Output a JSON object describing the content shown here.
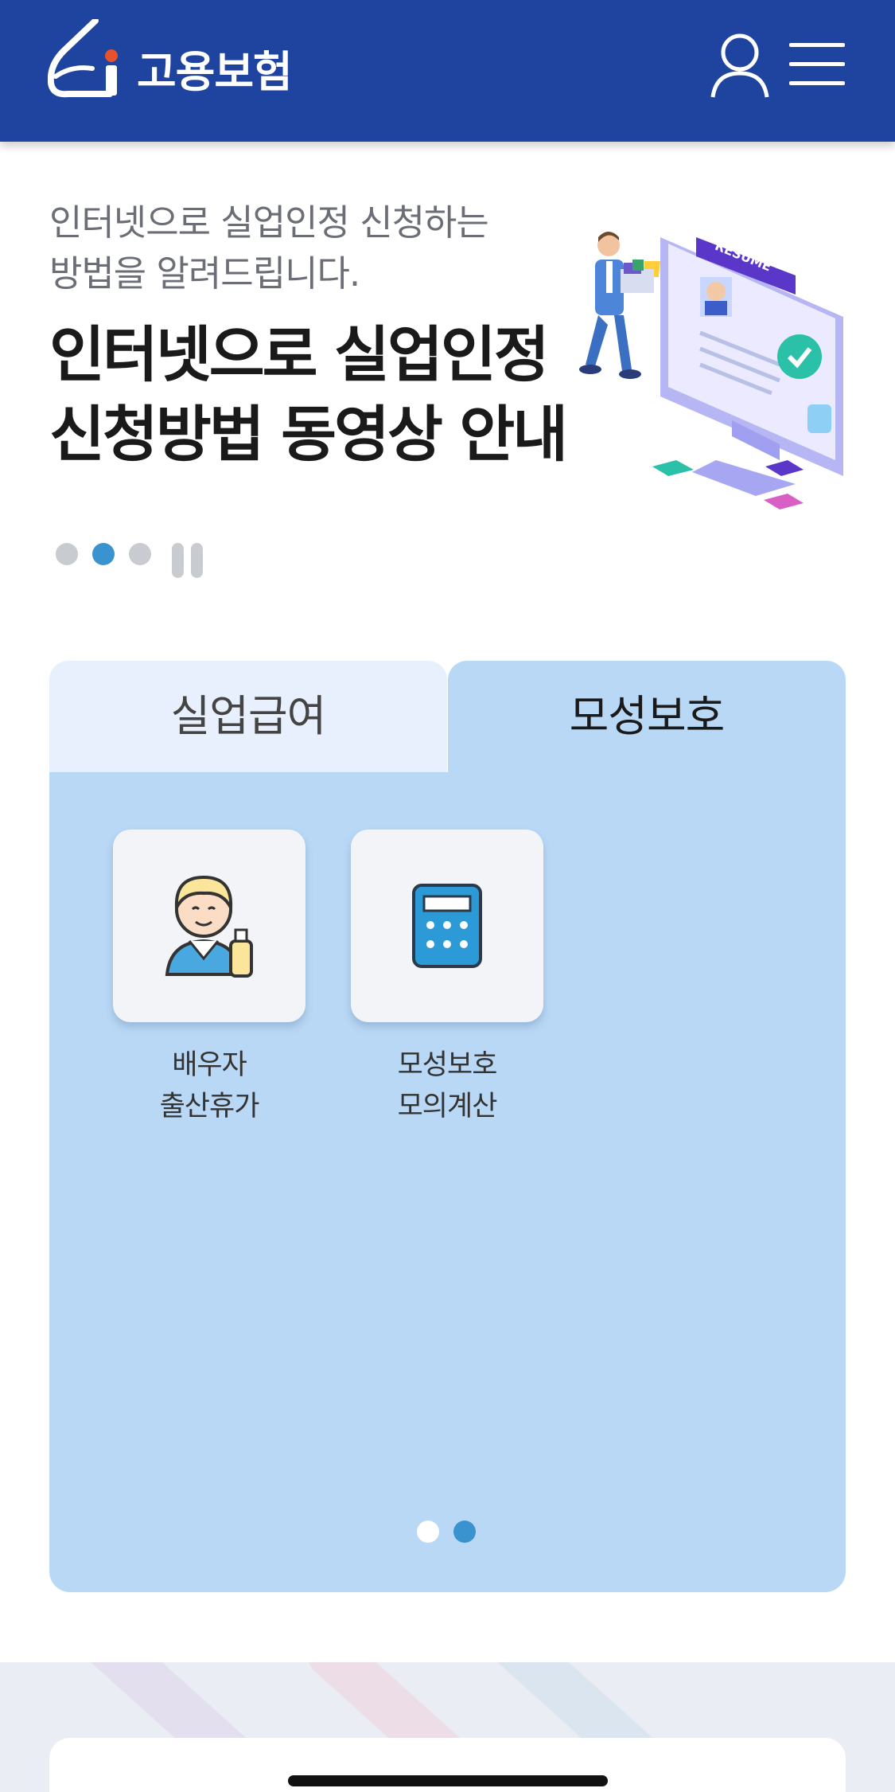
{
  "header": {
    "brand": "고용보험",
    "logo_icon": "ei-logo-icon",
    "user_icon": "user-icon",
    "menu_icon": "hamburger-menu-icon",
    "background": "#1f44a0"
  },
  "banner": {
    "subtitle_lines": [
      "인터넷으로 실업인정 신청하는",
      "방법을 알려드립니다."
    ],
    "title_lines": [
      "인터넷으로 실업인정",
      "신청방법 동영상 안내"
    ],
    "illustration_text": "RESUME",
    "slides": 3,
    "active_slide": 2
  },
  "tabs": [
    {
      "label": "실업급여",
      "selected": false
    },
    {
      "label": "모성보호",
      "selected": true
    }
  ],
  "cards": [
    {
      "icon": "parent-with-baby-bottle-icon",
      "lines": [
        "배우자",
        "출산휴가"
      ]
    },
    {
      "icon": "calculator-icon",
      "lines": [
        "모성보호",
        "모의계산"
      ]
    }
  ],
  "panel_pages": 2,
  "panel_active_page": 2,
  "colors": {
    "accent": "#3a93cf",
    "panel": "#b9d8f6",
    "tab_inactive": "#e8f0fd"
  }
}
